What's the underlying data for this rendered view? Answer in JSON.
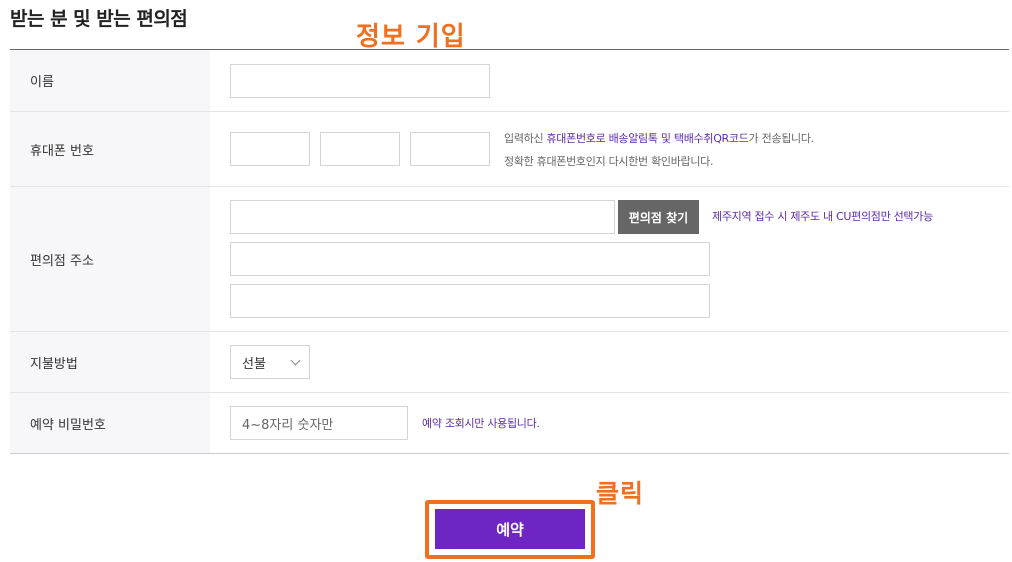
{
  "section_title": "받는 분 및 받는 편의점",
  "annotations": {
    "info": "정보 기입",
    "click": "클릭"
  },
  "form": {
    "name": {
      "label": "이름",
      "value": ""
    },
    "phone": {
      "label": "휴대폰 번호",
      "parts": [
        "",
        "",
        ""
      ],
      "note1_a": "입력하신 ",
      "note1_hl": "휴대폰번호로 배송알림톡 및 택배수취QR코드",
      "note1_b": "가 전송됩니다.",
      "note2": "정확한 휴대폰번호인지 다시한번 확인바랍니다."
    },
    "address": {
      "label": "편의점 주소",
      "find_button": "편의점 찾기",
      "note": "제주지역 접수 시 제주도 내 CU편의점만 선택가능",
      "lines": [
        "",
        "",
        ""
      ]
    },
    "payment": {
      "label": "지불방법",
      "selected": "선불"
    },
    "password": {
      "label": "예약 비밀번호",
      "placeholder": "4~8자리 숫자만",
      "note": "예약 조회시만 사용됩니다."
    }
  },
  "reserve_button": "예약",
  "colors": {
    "accent_purple": "#6f25c3",
    "annotation_orange": "#f26f1f"
  }
}
